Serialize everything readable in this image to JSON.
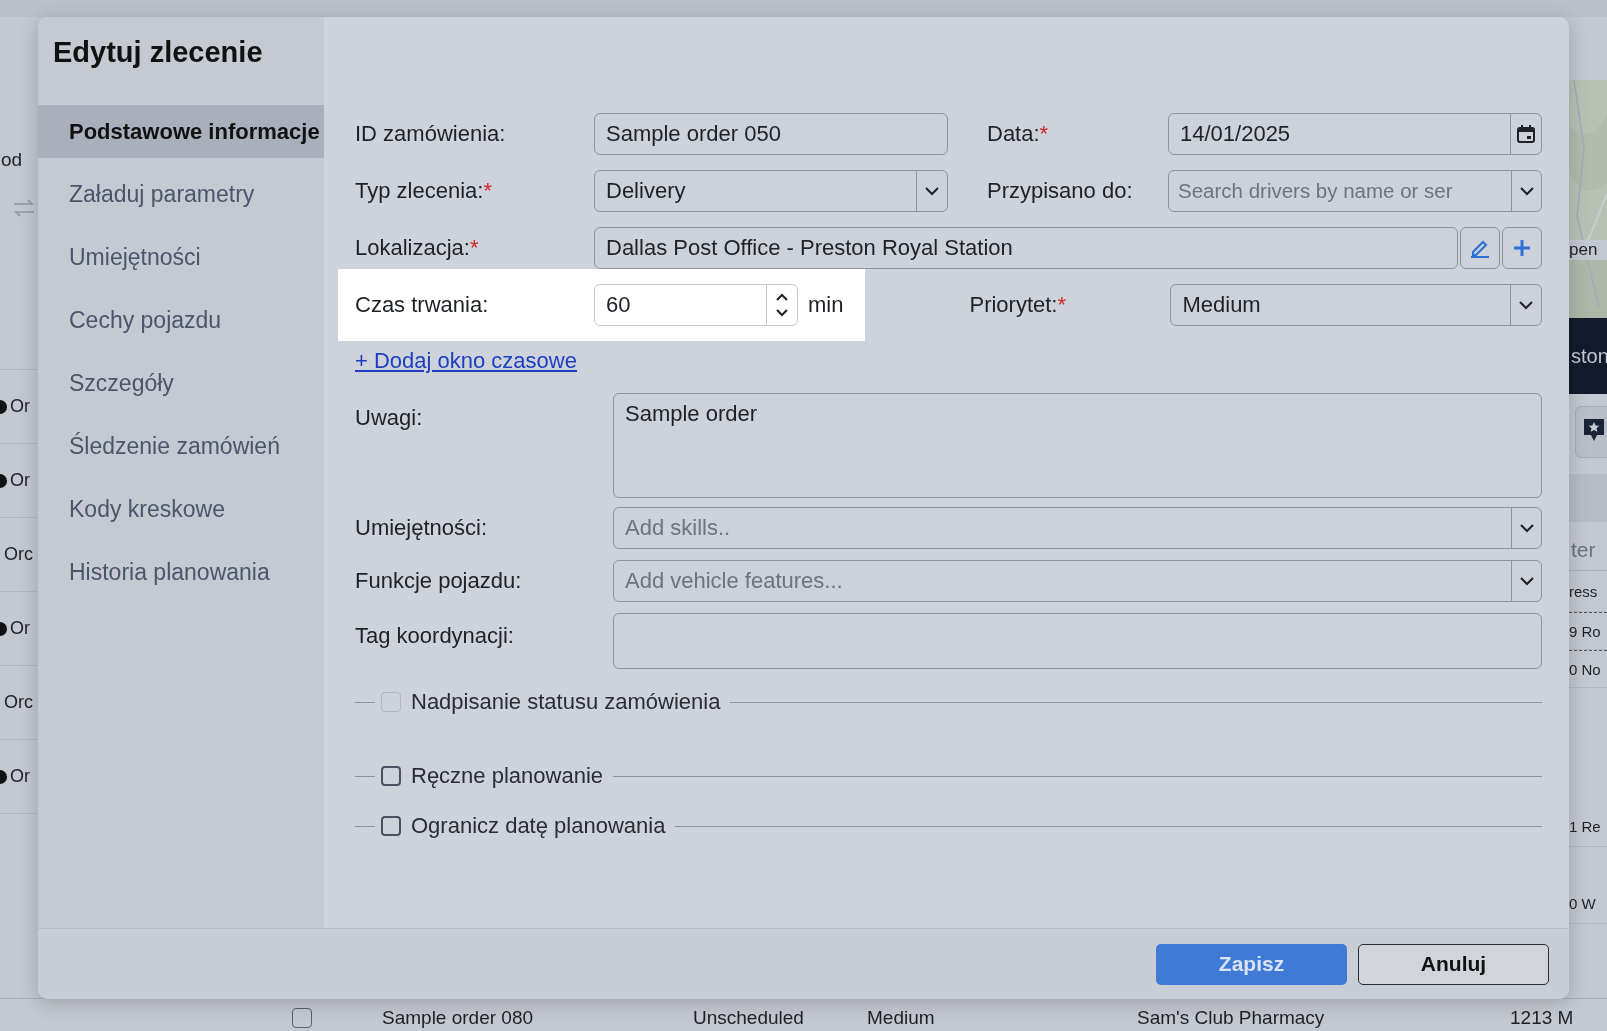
{
  "background": {
    "left": {
      "header": "od",
      "rows": [
        {
          "text": "Or",
          "marker": true
        },
        {
          "text": "Or",
          "marker": true
        },
        {
          "text": "Orc",
          "marker": false
        },
        {
          "text": "Or",
          "marker": true
        },
        {
          "text": "Orc",
          "marker": false
        },
        {
          "text": "Or",
          "marker": true
        }
      ]
    },
    "right": {
      "map_label": "pen",
      "banner": "ston",
      "filter_placeholder": "ter",
      "rows": [
        {
          "text": "ress",
          "dashed": false
        },
        {
          "text": "9 Ro",
          "dashed": true
        },
        {
          "text": "0 No",
          "dashed": true
        },
        {
          "text": "1 Re",
          "dashed": false
        },
        {
          "text": "0 W",
          "dashed": false
        }
      ]
    },
    "table_row": {
      "checked": false,
      "cells": [
        "Sample order 080",
        "Unscheduled",
        "Medium",
        "Sam's Club Pharmacy",
        "1213 M"
      ]
    }
  },
  "dialog": {
    "title": "Edytuj zlecenie",
    "nav": [
      {
        "label": "Podstawowe informacje",
        "selected": true
      },
      {
        "label": "Załaduj parametry",
        "selected": false
      },
      {
        "label": "Umiejętności",
        "selected": false
      },
      {
        "label": "Cechy pojazdu",
        "selected": false
      },
      {
        "label": "Szczegóły",
        "selected": false
      },
      {
        "label": "Śledzenie zamówień",
        "selected": false
      },
      {
        "label": "Kody kreskowe",
        "selected": false
      },
      {
        "label": "Historia planowania",
        "selected": false
      }
    ],
    "order_id": {
      "label": "ID zamówienia:",
      "value": "Sample order 050"
    },
    "date": {
      "label": "Data:",
      "required_mark": "*",
      "value": "14/01/2025"
    },
    "order_type": {
      "label": "Typ zlecenia:",
      "required_mark": "*",
      "value": "Delivery"
    },
    "assigned_to": {
      "label": "Przypisano do:",
      "placeholder": "Search drivers by name or ser"
    },
    "location": {
      "label": "Lokalizacja:",
      "required_mark": "*",
      "value": "Dallas Post Office - Preston Royal Station"
    },
    "duration": {
      "label": "Czas trwania:",
      "value": "60",
      "unit": "min",
      "highlighted": true
    },
    "priority": {
      "label": "Priorytet:",
      "required_mark": "*",
      "value": "Medium"
    },
    "add_time_window": "+ Dodaj okno czasowe",
    "notes": {
      "label": "Uwagi:",
      "value": "Sample order"
    },
    "skills": {
      "label": "Umiejętności:",
      "placeholder": "Add skills.."
    },
    "vehicle_features": {
      "label": "Funkcje pojazdu:",
      "placeholder": "Add vehicle features..."
    },
    "coordination_tag": {
      "label": "Tag koordynacji:"
    },
    "checkboxes": [
      {
        "label": "Nadpisanie statusu zamówienia",
        "checked": false,
        "disabled": true
      },
      {
        "label": "Ręczne planowanie",
        "checked": false,
        "disabled": false
      },
      {
        "label": "Ogranicz datę planowania",
        "checked": false,
        "disabled": false
      }
    ],
    "buttons": [
      {
        "label": "Zapisz",
        "kind": "primary"
      },
      {
        "label": "Anuluj",
        "kind": "secondary"
      }
    ]
  }
}
